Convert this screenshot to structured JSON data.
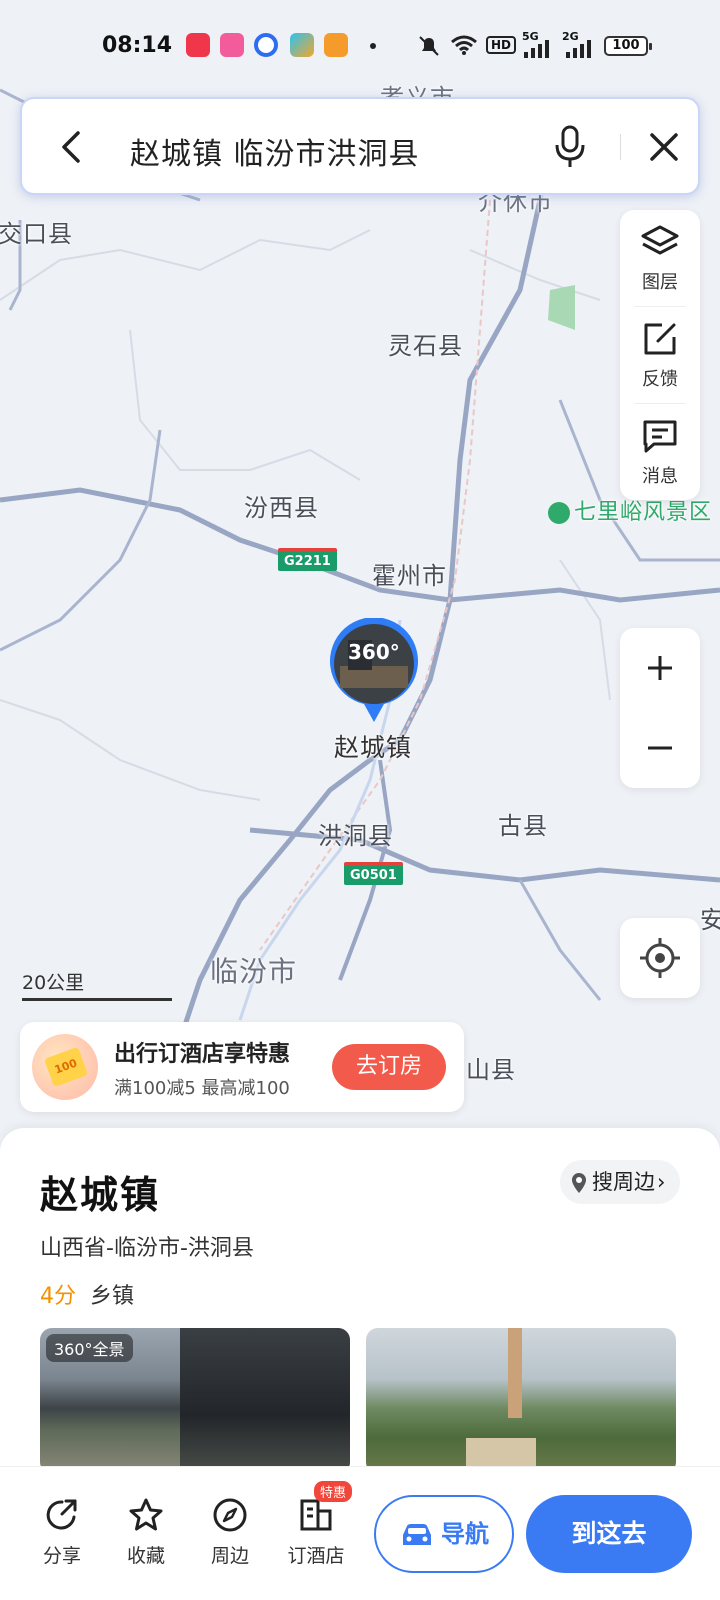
{
  "status_bar": {
    "time": "08:14",
    "signal_5g": "5G",
    "signal_2g": "2G",
    "hd": "HD",
    "battery": "100"
  },
  "search": {
    "query": "赵城镇 临汾市洪洞县",
    "back_icon": "chevron-left-icon",
    "mic_icon": "microphone-icon",
    "close_icon": "close-icon"
  },
  "map": {
    "labels": {
      "xiaoyi": "孝义市",
      "jiaokou": "交口县",
      "jiexiu": "介休市",
      "lingshi": "灵石县",
      "fenxi": "汾西县",
      "huozhou": "霍州市",
      "qilixia": "七里峪风景区",
      "gu": "古县",
      "hongdong": "洪洞县",
      "linfen": "临汾市",
      "an": "安",
      "shan": "山县"
    },
    "road_shields": {
      "g2211": "G2211",
      "g0501": "G0501"
    },
    "pin_label": "赵城镇",
    "pin_badge": "360°",
    "scale": "20公里"
  },
  "tools": {
    "layers": "图层",
    "feedback": "反馈",
    "messages": "消息"
  },
  "promo": {
    "title": "出行订酒店享特惠",
    "subtitle": "满100减5 最高减100",
    "button": "去订房",
    "coupon_value": "100"
  },
  "place": {
    "name": "赵城镇",
    "nearby": "搜周边",
    "address": "山西省-临汾市-洪洞县",
    "rating": "4分",
    "category": "乡镇",
    "pano_tag": "360°全景"
  },
  "actions": {
    "share": "分享",
    "favorite": "收藏",
    "around": "周边",
    "hotel": "订酒店",
    "hotel_badge": "特惠",
    "navigate": "导航",
    "go_there": "到这去"
  },
  "colors": {
    "accent": "#3a7bf4",
    "promo_button": "#f25b4c",
    "rating": "#f39200",
    "road_shield": "#1a9b6a"
  }
}
